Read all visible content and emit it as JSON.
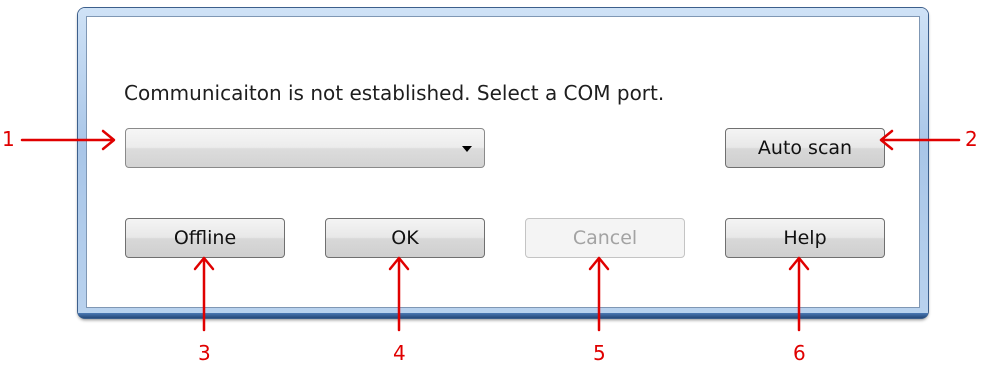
{
  "dialog": {
    "message": "Communicaiton is not established. Select a COM port.",
    "com_port_select": {
      "selected_value": ""
    },
    "buttons": {
      "auto_scan": "Auto scan",
      "offline": "Offline",
      "ok": "OK",
      "cancel": "Cancel",
      "help": "Help"
    },
    "cancel_enabled": false
  },
  "callouts": [
    "1",
    "2",
    "3",
    "4",
    "5",
    "6"
  ],
  "colors": {
    "callout": "#e00000",
    "frame_border": "#3c5f8c",
    "disabled_text": "#a3a3a3"
  },
  "icons": {
    "dropdown": "chevron-down-icon"
  }
}
